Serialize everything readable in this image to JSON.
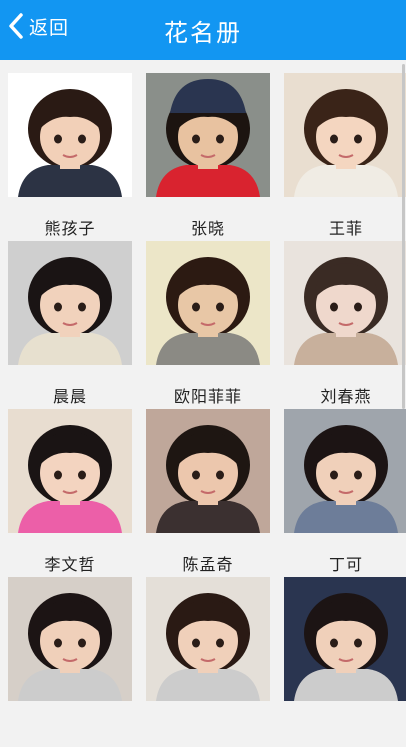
{
  "header": {
    "back_label": "返回",
    "title": "花名册",
    "color": "#1296f2"
  },
  "roster": [
    {
      "name": "熊孩子",
      "bg": "#ffffff",
      "hair": "#2a1a14",
      "skin": "#f2d0b8",
      "shirt": "#2c3344",
      "hat": ""
    },
    {
      "name": "张晓",
      "bg": "#8a8f8a",
      "hair": "#1c1410",
      "skin": "#e8c2a0",
      "shirt": "#d9232f",
      "hat": "#2a3550"
    },
    {
      "name": "王菲",
      "bg": "#e9ded0",
      "hair": "#3a2418",
      "skin": "#f4d6c0",
      "shirt": "#f0ece4",
      "hat": ""
    },
    {
      "name": "晨晨",
      "bg": "#cfcfcf",
      "hair": "#1a1414",
      "skin": "#f1d2bc",
      "shirt": "#e7e0cf",
      "hat": ""
    },
    {
      "name": "欧阳菲菲",
      "bg": "#ece6c8",
      "hair": "#2c1a12",
      "skin": "#e8c7a6",
      "shirt": "#8b8a84",
      "hat": ""
    },
    {
      "name": "刘春燕",
      "bg": "#e9e3dd",
      "hair": "#3a2b24",
      "skin": "#efd8cc",
      "shirt": "#c8b09c",
      "hat": ""
    },
    {
      "name": "李文哲",
      "bg": "#e8ddd0",
      "hair": "#1a1414",
      "skin": "#f3d4c0",
      "shirt": "#ec5fa8",
      "hat": ""
    },
    {
      "name": "陈孟奇",
      "bg": "#bfa79a",
      "hair": "#1e1612",
      "skin": "#ecc7ad",
      "shirt": "#3b3030",
      "hat": ""
    },
    {
      "name": "丁可",
      "bg": "#9fa5ac",
      "hair": "#1c1414",
      "skin": "#f0d0ba",
      "shirt": "#6d7d99",
      "hat": ""
    },
    {
      "name": "",
      "bg": "#d6cfc8",
      "hair": "#1c1414",
      "skin": "#f0d0ba",
      "shirt": "#cccccc",
      "hat": ""
    },
    {
      "name": "",
      "bg": "#e4dfd8",
      "hair": "#2a1a14",
      "skin": "#f0d0ba",
      "shirt": "#cccccc",
      "hat": ""
    },
    {
      "name": "",
      "bg": "#2a3550",
      "hair": "#1c1414",
      "skin": "#f0d0ba",
      "shirt": "#cccccc",
      "hat": ""
    }
  ]
}
